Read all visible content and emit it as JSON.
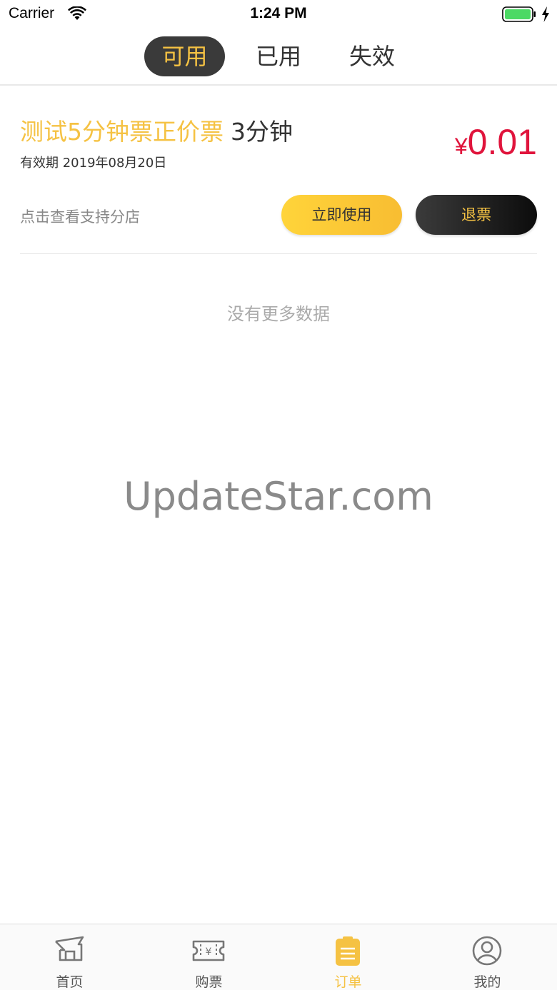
{
  "status_bar": {
    "carrier": "Carrier",
    "time": "1:24 PM"
  },
  "tabs": [
    {
      "label": "可用",
      "active": true
    },
    {
      "label": "已用",
      "active": false
    },
    {
      "label": "失效",
      "active": false
    }
  ],
  "ticket": {
    "name": "测试5分钟票正价票",
    "duration": "3分钟",
    "validity": "有效期 2019年08月20日",
    "price_symbol": "¥",
    "price": "0.01",
    "branch_link": "点击查看支持分店",
    "use_label": "立即使用",
    "refund_label": "退票"
  },
  "list": {
    "empty_message": "没有更多数据"
  },
  "watermark": "UpdateStar.com",
  "bottom_nav": [
    {
      "label": "首页",
      "icon": "home-icon"
    },
    {
      "label": "购票",
      "icon": "ticket-icon"
    },
    {
      "label": "订单",
      "icon": "order-icon",
      "active": true
    },
    {
      "label": "我的",
      "icon": "profile-icon"
    }
  ],
  "colors": {
    "accent": "#f5c243",
    "price": "#e0143c",
    "dark": "#3a3a3a"
  }
}
